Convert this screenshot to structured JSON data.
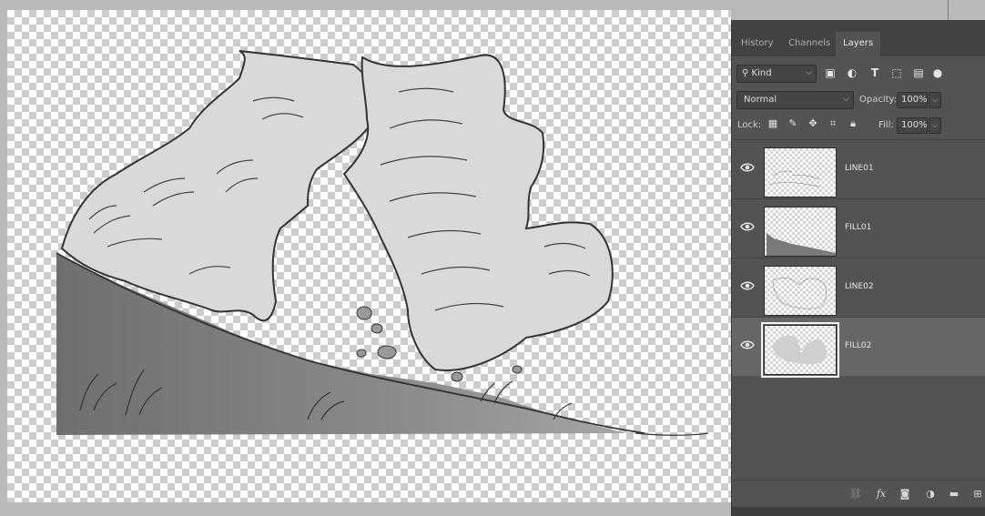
{
  "panel": {
    "tabs": [
      {
        "label": "History",
        "active": false
      },
      {
        "label": "Channels",
        "active": false
      },
      {
        "label": "Layers",
        "active": true
      }
    ],
    "filter": {
      "kind_label": "Kind",
      "icons": [
        "image-filter-icon",
        "adjustment-filter-icon",
        "type-filter-icon",
        "shape-filter-icon",
        "smart-object-filter-icon",
        "filter-toggle-icon"
      ]
    },
    "blend": {
      "mode": "Normal",
      "opacity_label": "Opacity:",
      "opacity_value": "100%"
    },
    "lock": {
      "label": "Lock:",
      "icons": [
        "lock-transparent-pixels-icon",
        "lock-image-pixels-icon",
        "lock-position-icon",
        "lock-artboard-icon",
        "lock-all-icon"
      ],
      "fill_label": "Fill:",
      "fill_value": "100%"
    },
    "layers": [
      {
        "name": "LINE01",
        "visible": true,
        "selected": false
      },
      {
        "name": "FILL01",
        "visible": true,
        "selected": false
      },
      {
        "name": "LINE02",
        "visible": true,
        "selected": false
      },
      {
        "name": "FILL02",
        "visible": true,
        "selected": true
      }
    ],
    "bottom_icons": [
      "link-layers-icon",
      "fx-icon",
      "layer-mask-icon",
      "adjustment-layer-icon",
      "new-group-icon",
      "new-layer-icon"
    ],
    "fx_label": "fx"
  },
  "colors": {
    "panel_bg": "#535353",
    "tab_bar_bg": "#424242",
    "selected_layer_bg": "#666666",
    "canvas_gray": "#b9b9b9"
  }
}
